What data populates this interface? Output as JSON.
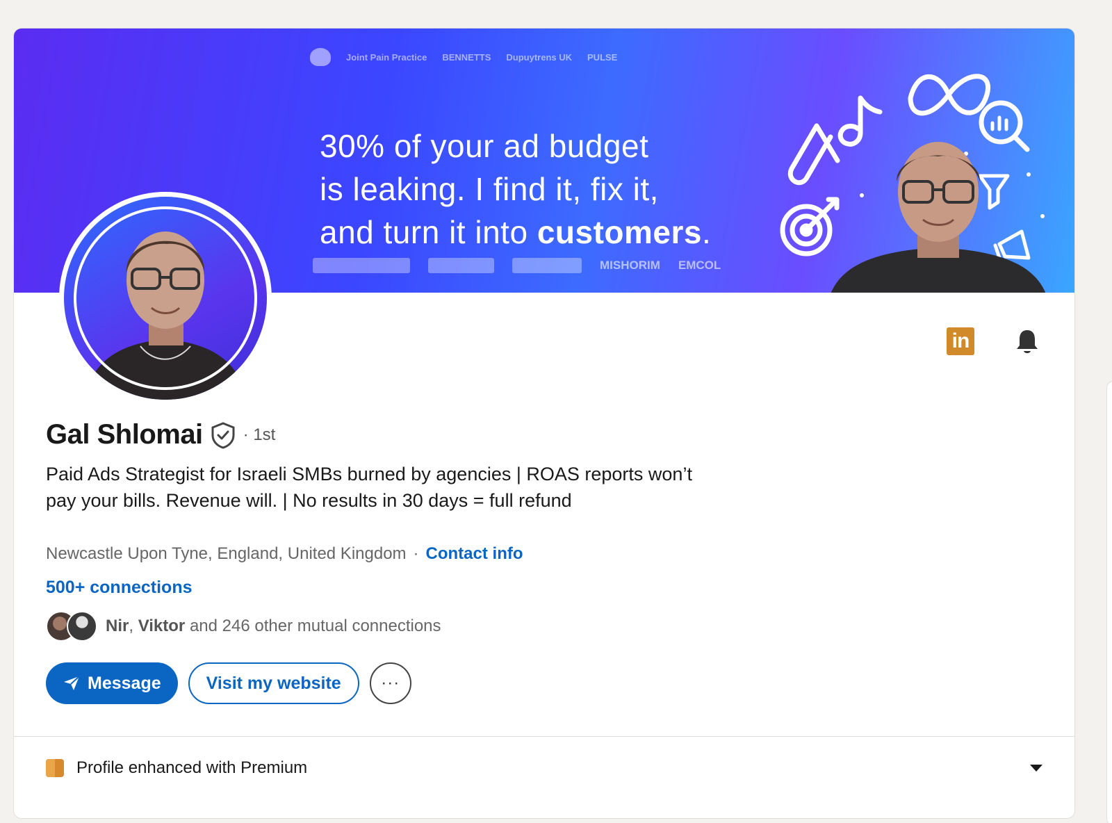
{
  "banner": {
    "logos_top": [
      "Joint Pain Practice",
      "BENNETTS",
      "Dupuytrens UK",
      "PULSE"
    ],
    "headline_line1": "30% of your ad budget",
    "headline_line2": "is leaking. I find it, fix it,",
    "headline_line3_plain": "and turn it into ",
    "headline_line3_bold": "customers",
    "headline_line3_end": ".",
    "logos_bottom": [
      "MISHORIM",
      "EMCOL"
    ]
  },
  "profile": {
    "name": "Gal Shlomai",
    "degree": "· 1st",
    "headline": "Paid Ads Strategist for Israeli SMBs burned by agencies | ROAS reports won’t pay your bills. Revenue will. | No results in 30 days = full refund",
    "location": "Newcastle Upon Tyne, England, United Kingdom",
    "contact_sep": "·",
    "contact_info": "Contact info",
    "connections": "500+ connections",
    "mutual_name1": "Nir",
    "mutual_sep": ", ",
    "mutual_name2": "Viktor",
    "mutual_rest": " and 246 other mutual connections"
  },
  "actions": {
    "message_label": "Message",
    "website_label": "Visit my website",
    "more_label": "···"
  },
  "premium": {
    "label": "Profile enhanced with Premium"
  },
  "colors": {
    "accent": "#0a66c2",
    "premium": "#d6892d"
  },
  "icons": [
    "linkedin-premium-icon",
    "bell-icon",
    "verified-shield-icon",
    "send-icon",
    "more-icon",
    "premium-badge-icon",
    "caret-down-icon"
  ]
}
